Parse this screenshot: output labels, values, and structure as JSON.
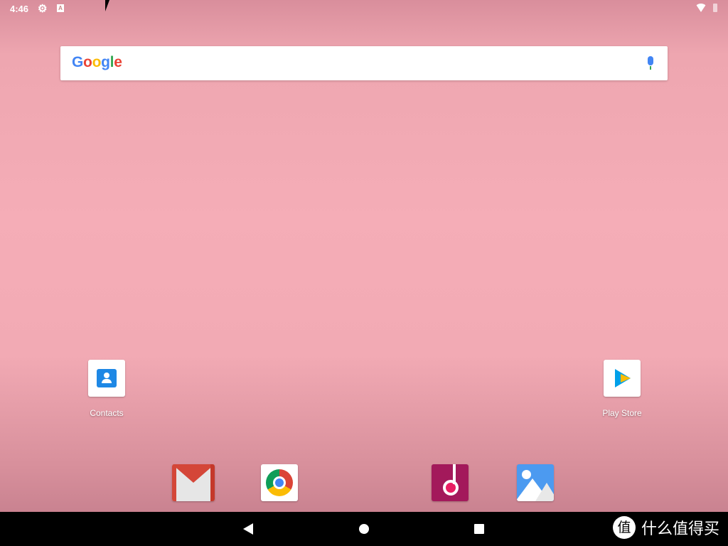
{
  "status_bar": {
    "time": "4:46",
    "icons": [
      "settings-gear-icon",
      "keyboard-a-icon",
      "wifi-icon",
      "battery-icon"
    ]
  },
  "search": {
    "logo": [
      "G",
      "o",
      "o",
      "g",
      "l",
      "e"
    ],
    "logo_colors": [
      "#4285f4",
      "#ea4335",
      "#fbbc05",
      "#4285f4",
      "#34a853",
      "#ea4335"
    ],
    "mic_icon": "mic-icon"
  },
  "apps": {
    "contacts": "Contacts",
    "play_store": "Play Store"
  },
  "dock": [
    "gmail-icon",
    "chrome-icon",
    "music-icon",
    "gallery-icon"
  ],
  "nav": [
    "back",
    "home",
    "recents"
  ],
  "watermark": {
    "badge": "值",
    "text": "什么值得买"
  }
}
